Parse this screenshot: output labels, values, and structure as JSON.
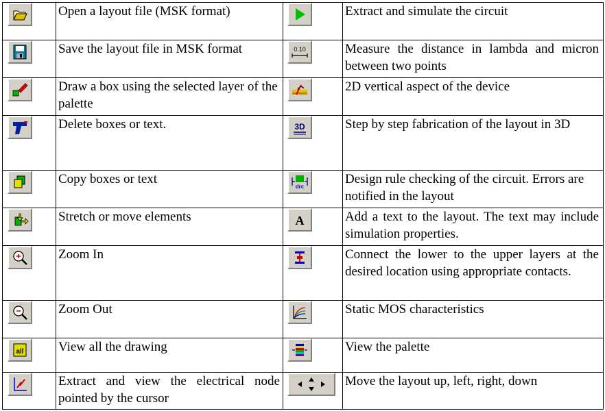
{
  "rows": [
    {
      "left": "Open a layout file (MSK format)",
      "right": "Extract and simulate the circuit"
    },
    {
      "left": "Save the layout file in MSK format",
      "right": "Measure the distance in lambda and micron between two points"
    },
    {
      "left": "Draw a box using the selected layer of the palette",
      "right": "2D vertical aspect of the device"
    },
    {
      "left": "Delete boxes or text.",
      "right": "Step by step fabrication of the layout in 3D"
    },
    {
      "left": "Copy boxes or text",
      "right": "Design rule checking of the circuit. Errors are notified in the layout"
    },
    {
      "left": "Stretch or move elements",
      "right": "Add a text to the layout. The text may include simulation properties."
    },
    {
      "left": "Zoom In",
      "right": "Connect the lower to the upper layers at the desired location using appropriate contacts."
    },
    {
      "left": "Zoom Out",
      "right": "Static MOS characteristics"
    },
    {
      "left": "View all the drawing",
      "right": "View the palette"
    },
    {
      "left": "Extract and view the electrical node pointed by the cursor",
      "right": "Move the layout up, left, right, down"
    }
  ],
  "icon_glyphs": {
    "measure": "0.10",
    "fab3d": "3D",
    "drc": "drc",
    "text": "A",
    "viewall": "all"
  },
  "icons_left": [
    "folder-open-icon",
    "floppy-disk-icon",
    "draw-box-icon",
    "delete-gun-icon",
    "copy-icon",
    "stretch-move-icon",
    "zoom-in-icon",
    "zoom-out-icon",
    "view-all-icon",
    "node-extract-icon"
  ],
  "icons_right": [
    "simulate-play-icon",
    "measure-ruler-icon",
    "cross-section-icon",
    "fabrication-3d-icon",
    "drc-icon",
    "add-text-icon",
    "contact-icon",
    "mos-characteristics-icon",
    "palette-icon",
    "move-arrows-icon"
  ],
  "colors": {
    "button_face": "#d4d0c8",
    "play_green": "#00c000"
  }
}
